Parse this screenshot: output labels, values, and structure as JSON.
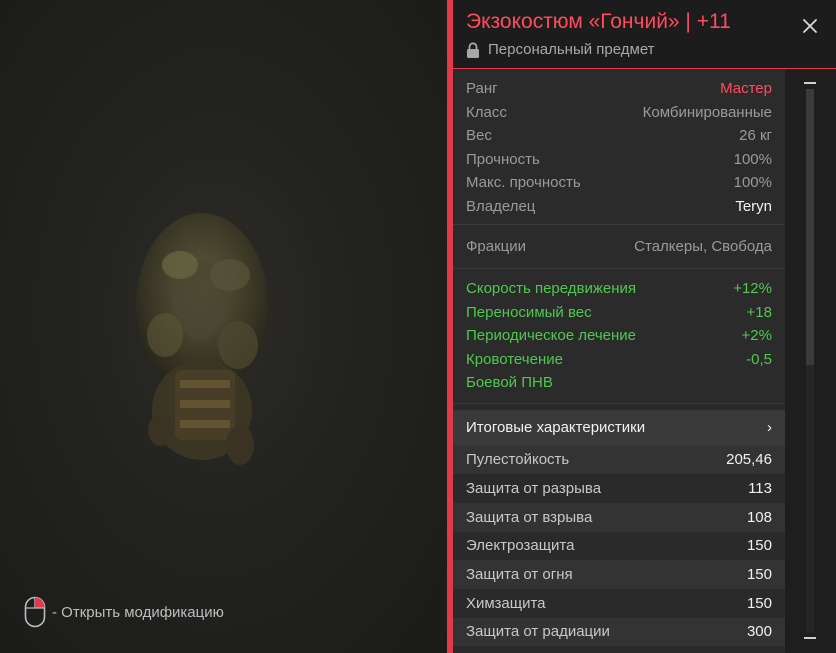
{
  "header": {
    "title": "Экзокостюм «Гончий» | +11",
    "subtitle": "Персональный предмет"
  },
  "hint": "- Открыть модификацию",
  "info": [
    {
      "label": "Ранг",
      "value": "Мастер"
    },
    {
      "label": "Класс",
      "value": "Комбинированные"
    },
    {
      "label": "Вес",
      "value": "26 кг"
    },
    {
      "label": "Прочность",
      "value": "100%"
    },
    {
      "label": "Макс. прочность",
      "value": "100%"
    },
    {
      "label": "Владелец",
      "value": "Teryn"
    }
  ],
  "factions": {
    "label": "Фракции",
    "value": "Сталкеры, Свобода"
  },
  "bonuses": [
    {
      "label": "Скорость передвижения",
      "value": "+12%"
    },
    {
      "label": "Переносимый вес",
      "value": "+18"
    },
    {
      "label": "Периодическое лечение",
      "value": "+2%"
    },
    {
      "label": "Кровотечение",
      "value": "-0,5"
    },
    {
      "label": "Боевой ПНВ",
      "value": ""
    }
  ],
  "totals": {
    "label": "Итоговые характеристики",
    "chevron": "›"
  },
  "stats": [
    {
      "label": "Пулестойкость",
      "value": "205,46"
    },
    {
      "label": "Защита от разрыва",
      "value": "113"
    },
    {
      "label": "Защита от взрыва",
      "value": "108"
    },
    {
      "label": "Электрозащита",
      "value": "150"
    },
    {
      "label": "Защита от огня",
      "value": "150"
    },
    {
      "label": "Химзащита",
      "value": "150"
    },
    {
      "label": "Защита от радиации",
      "value": "300"
    }
  ],
  "colors": {
    "accent": "#e23a4b",
    "positive": "#4ec94e",
    "rank": "#ff4b5c"
  },
  "icons": {
    "close": "close-icon",
    "lock": "lock-icon",
    "mouse": "mouse-icon",
    "chevron": "chevron-right-icon"
  }
}
